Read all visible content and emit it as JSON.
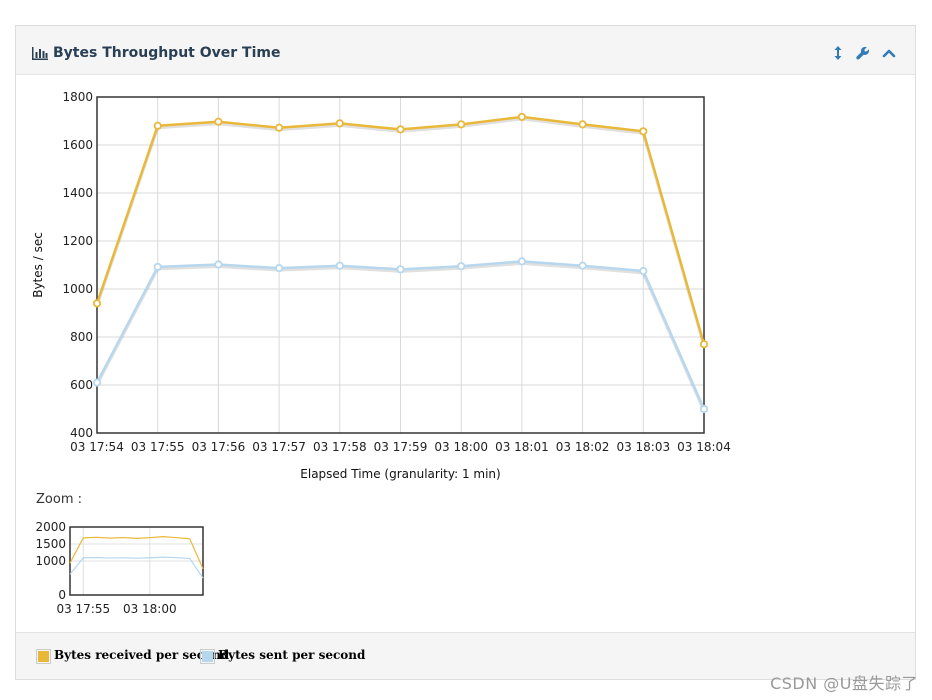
{
  "panel": {
    "title": "Bytes Throughput Over Time",
    "icons": [
      "bar-chart-icon",
      "resize-vertical-icon",
      "wrench-icon",
      "chevron-up-icon"
    ]
  },
  "zoom": {
    "label": "Zoom :",
    "y_ticks": [
      "2000",
      "1500",
      "1000",
      "0"
    ],
    "x_ticks": [
      "03 17:55",
      "03 18:00"
    ]
  },
  "legend": [
    {
      "label": "Bytes received per second",
      "color": "#eab839"
    },
    {
      "label": "Bytes sent per second",
      "color": "#b6d7ed"
    }
  ],
  "watermark": "CSDN @U盘失踪了",
  "chart_data": {
    "type": "line",
    "title": "",
    "xlabel": "Elapsed Time (granularity: 1 min)",
    "ylabel": "Bytes / sec",
    "categories": [
      "03 17:54",
      "03 17:55",
      "03 17:56",
      "03 17:57",
      "03 17:58",
      "03 17:59",
      "03 18:00",
      "03 18:01",
      "03 18:02",
      "03 18:03",
      "03 18:04"
    ],
    "ylim": [
      400,
      1800
    ],
    "yticks": [
      400,
      600,
      800,
      1000,
      1200,
      1400,
      1600,
      1800
    ],
    "grid": true,
    "legend": "bottom",
    "series": [
      {
        "name": "Bytes received per second",
        "color": "#eab839",
        "values": [
          940,
          1680,
          1697,
          1672,
          1690,
          1665,
          1686,
          1717,
          1686,
          1657,
          770
        ]
      },
      {
        "name": "Bytes sent per second",
        "color": "#b6d7ed",
        "values": [
          610,
          1092,
          1102,
          1087,
          1097,
          1082,
          1095,
          1115,
          1097,
          1075,
          500
        ]
      }
    ]
  }
}
